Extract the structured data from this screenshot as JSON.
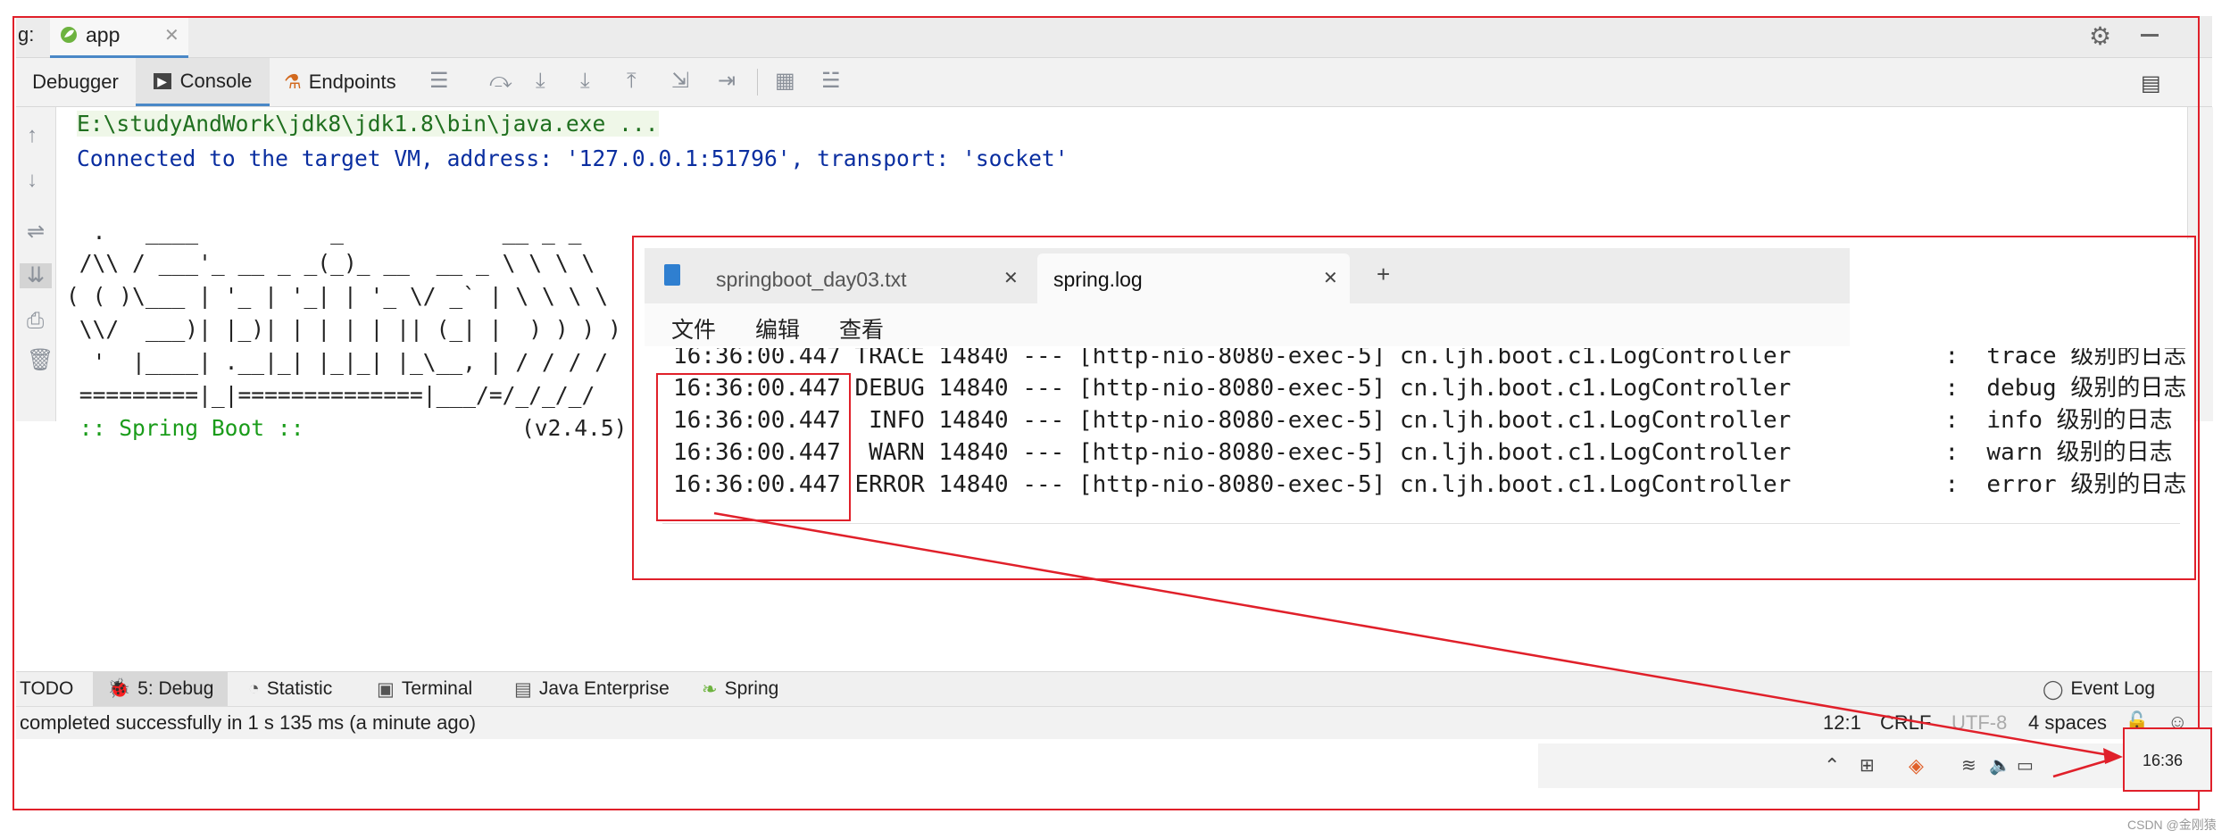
{
  "run_tab": {
    "prefix": "g:",
    "name": "app"
  },
  "debug_toolbar": {
    "tabs": [
      "Debugger",
      "Console",
      "Endpoints"
    ]
  },
  "console": {
    "lines": [
      "E:\\studyAndWork\\jdk8\\jdk1.8\\bin\\java.exe ...",
      "Connected to the target VM, address: '127.0.0.1:51796', transport: 'socket'"
    ],
    "banner": [
      "  .   ____          _            __ _ _",
      " /\\\\ / ___'_ __ _ _(_)_ __  __ _ \\ \\ \\ \\",
      "( ( )\\___ | '_ | '_| | '_ \\/ _` | \\ \\ \\ \\",
      " \\\\/  ___)| |_)| | | | | || (_| |  ) ) ) )",
      "  '  |____| .__|_| |_|_| |_\\__, | / / / /",
      " =========|_|==============|___/=/_/_/_/"
    ],
    "spring_label": " :: Spring Boot :: ",
    "spring_version": "(v2.4.5)"
  },
  "notepad": {
    "tabs": [
      "springboot_day03.txt",
      "spring.log"
    ],
    "menu": [
      "文件",
      "编辑",
      "查看"
    ],
    "log_lines": [
      {
        "time": "16:36:00.447",
        "rest": " TRACE 14840 --- [http-nio-8080-exec-5] cn.ljh.boot.c1.LogController           :  trace 级别的日志"
      },
      {
        "time": "16:36:00.447",
        "rest": " DEBUG 14840 --- [http-nio-8080-exec-5] cn.ljh.boot.c1.LogController           :  debug 级别的日志"
      },
      {
        "time": "16:36:00.447",
        "rest": "  INFO 14840 --- [http-nio-8080-exec-5] cn.ljh.boot.c1.LogController           :  info 级别的日志"
      },
      {
        "time": "16:36:00.447",
        "rest": "  WARN 14840 --- [http-nio-8080-exec-5] cn.ljh.boot.c1.LogController           :  warn 级别的日志"
      },
      {
        "time": "16:36:00.447",
        "rest": " ERROR 14840 --- [http-nio-8080-exec-5] cn.ljh.boot.c1.LogController           :  error 级别的日志"
      }
    ]
  },
  "bottom_tabs": [
    "TODO",
    "5: Debug",
    "Statistic",
    "Terminal",
    "Java Enterprise",
    "Spring"
  ],
  "event_log": "Event Log",
  "status_bar": {
    "message": "completed successfully in 1 s 135 ms (a minute ago)",
    "position": "12:1",
    "line_ending": "CRLF",
    "encoding": "UTF-8",
    "indent": "4 spaces"
  },
  "taskbar": {
    "clock": "16:36"
  },
  "watermark": "CSDN @金刚猿",
  "colors": {
    "red_annotation": "#e0202a",
    "console_blue": "#0a2ea0",
    "console_green": "#1a9c1a",
    "toolbar_bg": "#f2f2f2"
  }
}
